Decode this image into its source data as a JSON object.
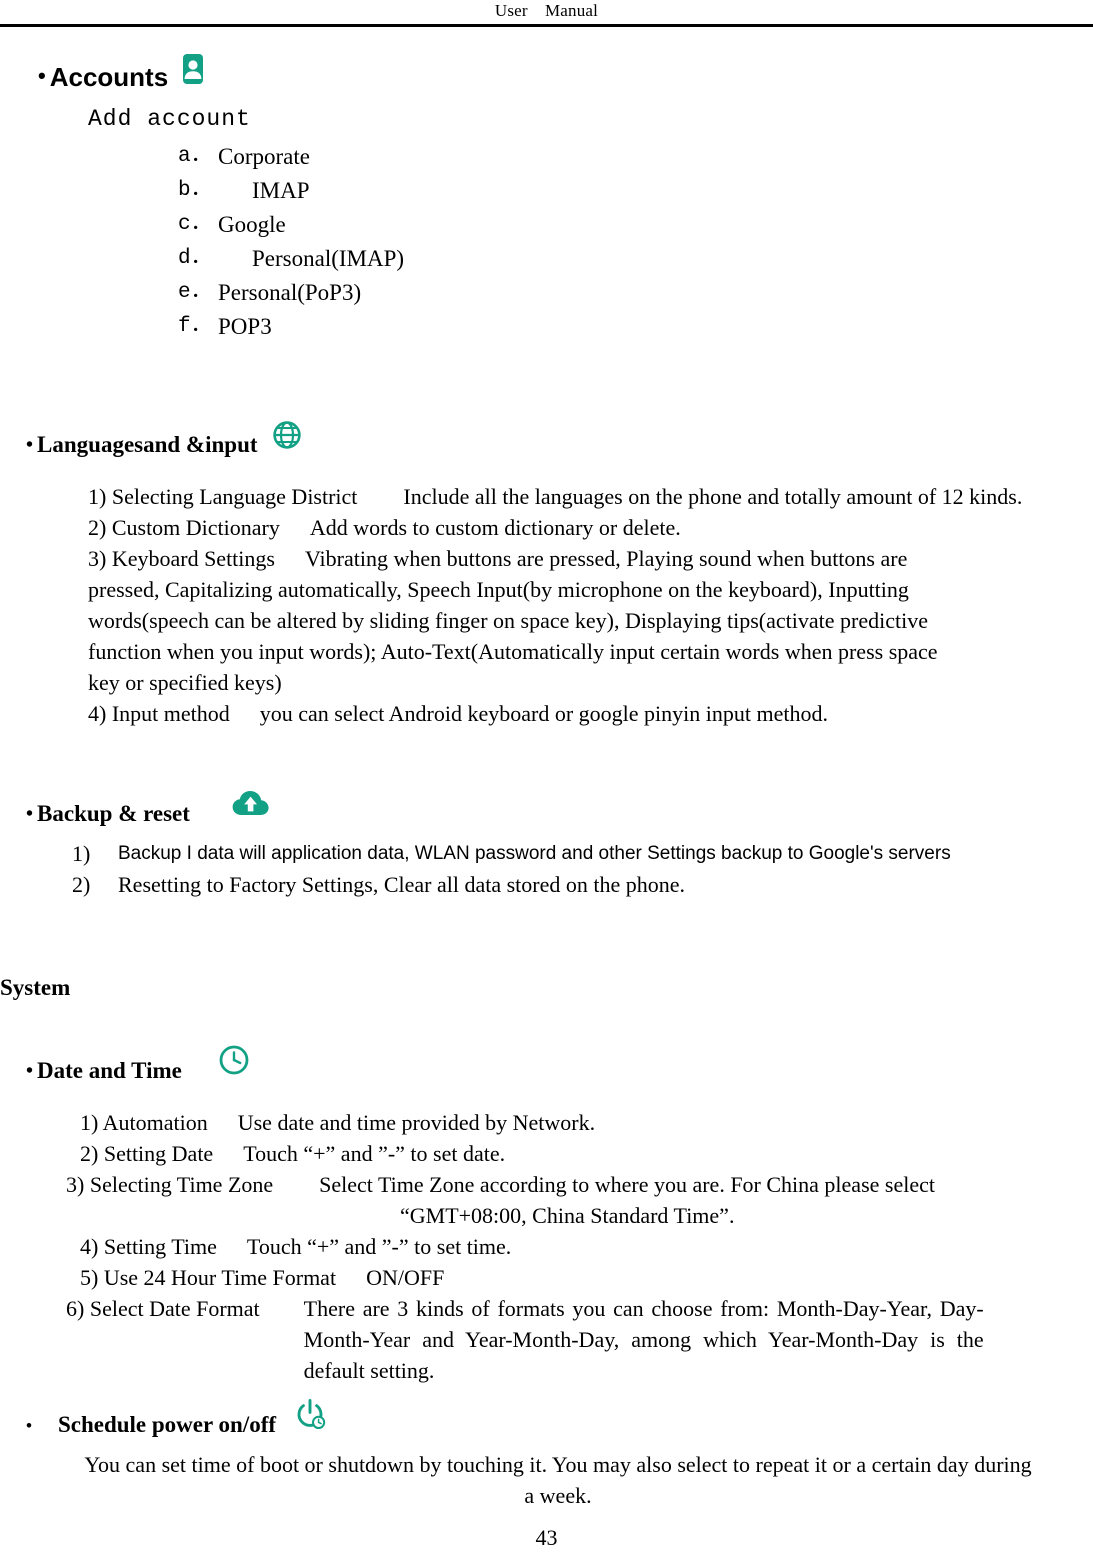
{
  "header": {
    "title": "User　Manual"
  },
  "page_number": "43",
  "accent_color": "#12A185",
  "sections": {
    "accounts": {
      "heading": "Accounts",
      "icon": "contacts-account-icon",
      "sub_heading": "Add account",
      "items": [
        {
          "marker": "a．",
          "label": "Corporate",
          "indent": false
        },
        {
          "marker": "b．",
          "label": "IMAP",
          "indent": true
        },
        {
          "marker": "c．",
          "label": "Google",
          "indent": false
        },
        {
          "marker": "d．",
          "label": "Personal(IMAP)",
          "indent": true
        },
        {
          "marker": "e．",
          "label": "Personal(PoP3)",
          "indent": false
        },
        {
          "marker": "f．",
          "label": "POP3",
          "indent": false
        }
      ]
    },
    "languages": {
      "heading": "Languagesand &input",
      "icon": "globe-language-icon",
      "items": [
        {
          "marker": "1)",
          "term": "Selecting Language District",
          "desc": "Include all the languages on the phone and totally amount of 12 kinds."
        },
        {
          "marker": "2)",
          "term": "Custom Dictionary",
          "desc": "Add words to custom dictionary or delete."
        },
        {
          "marker": "3)",
          "term": "Keyboard Settings",
          "desc": "Vibrating when buttons are pressed, Playing sound when buttons are pressed, Capitalizing automatically, Speech Input(by microphone on the keyboard), Inputting words(speech can be altered by sliding finger on space key), Displaying tips(activate predictive function when you input words); Auto-Text(Automatically input certain words when press space key or specified keys)"
        },
        {
          "marker": "4)",
          "term": "Input method",
          "desc": "you can select Android keyboard or google pinyin input method."
        }
      ]
    },
    "backup": {
      "heading": "Backup & reset",
      "icon": "cloud-upload-backup-icon",
      "items": [
        {
          "marker": "1)",
          "text": "Backup I data will application data, WLAN password and other Settings backup to Google's servers"
        },
        {
          "marker": "2)",
          "text": "Resetting to Factory Settings, Clear all data stored on the phone."
        }
      ]
    },
    "system": {
      "title": "System"
    },
    "date_and_time": {
      "heading": "Date and Time",
      "icon": "clock-time-icon",
      "items": [
        {
          "marker": "1)",
          "term": "Automation",
          "desc": "Use date and time provided by Network.",
          "cont": ""
        },
        {
          "marker": "2)",
          "term": "Setting Date",
          "desc": "Touch “+” and ”-” to set date.",
          "cont": ""
        },
        {
          "marker": "3)",
          "term": "Selecting Time Zone",
          "desc": "Select Time Zone according to where you are. For China please select",
          "cont": "“GMT+08:00, China Standard Time”."
        },
        {
          "marker": "4)",
          "term": "Setting Time",
          "desc": "Touch “+” and ”-” to set time.",
          "cont": ""
        },
        {
          "marker": "5)",
          "term": "Use 24 Hour Time Format",
          "desc": "ON/OFF",
          "cont": ""
        },
        {
          "marker": "6)",
          "term": "Select Date Format",
          "desc": "There are 3 kinds of formats you can choose from: Month-Day-Year, Day-Month-Year and Year-Month-Day, among which Year-Month-Day is the default setting.",
          "cont": ""
        }
      ]
    },
    "schedule_power": {
      "heading": "Schedule power on/off",
      "icon": "power-schedule-icon",
      "body": "You can set time of boot or shutdown by touching it. You may also select to repeat it or a certain day during a week."
    }
  }
}
